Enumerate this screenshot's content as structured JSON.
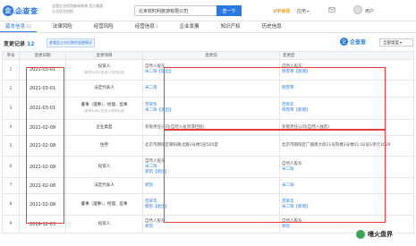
{
  "header": {
    "logo_char": "企",
    "logo_text": "企查查",
    "logo_domain": "qcc.com",
    "slogan": "全国企业信用查询系统 官方备案企业征信机构",
    "search_value": "北京欢时利旅游有限公司",
    "search_button": "查一下",
    "vip_label": "VIP会员",
    "app_label": "应用",
    "user_name": "用户"
  },
  "tabs": [
    {
      "label": "基本信息",
      "count": "33"
    },
    {
      "label": "法律风险",
      "count": ""
    },
    {
      "label": "经营风险",
      "count": ""
    },
    {
      "label": "经营信息",
      "count": "3"
    },
    {
      "label": "企业发展",
      "count": ""
    },
    {
      "label": "知识产权",
      "count": ""
    },
    {
      "label": "历史信息",
      "count": ""
    }
  ],
  "section": {
    "title": "变更记录",
    "count": "12",
    "hint": "查看此企业近期的变更情况",
    "logo_char": "企",
    "logo_text": "企查查",
    "filter_label": "全部类型"
  },
  "table": {
    "headers": [
      "序号",
      "变更日期",
      "变更项目",
      "变更前",
      "变更后"
    ],
    "rows": [
      {
        "no": "1",
        "date": "2021-03-01",
        "item": "投资人",
        "note": "(事项为何以投资人列项出现)",
        "before": [
          {
            "t": "自然人股东",
            "c": "g"
          },
          {
            "t": "米二阳【退出】",
            "c": "b"
          }
        ],
        "after": [
          {
            "t": "自然人股东",
            "c": "g"
          },
          {
            "t": "晓雪琴【新增】",
            "c": "b"
          }
        ]
      },
      {
        "no": "2",
        "date": "2021-03-01",
        "item": "法定代表人",
        "note": "",
        "before": [
          {
            "t": "米二阳",
            "c": "b"
          }
        ],
        "after": [
          {
            "t": "晓雪琴",
            "c": "b"
          }
        ]
      },
      {
        "no": "3",
        "date": "2021-03-01",
        "item": "董事（理事）、经理、监事",
        "note": "(事项为何以投资人列项出现)",
        "before": [
          {
            "t": "范荣华",
            "c": "b"
          },
          {
            "t": "米二阳【退出】",
            "c": "b"
          }
        ],
        "after": [
          {
            "t": "范荣华",
            "c": "b"
          },
          {
            "t": "晓雪琴【新增】",
            "c": "b"
          }
        ]
      },
      {
        "no": "4",
        "date": "2021-02-08",
        "item": "企业类型",
        "note": "",
        "before": [
          {
            "t": "有限责任公司(自然人投资或控股)",
            "c": "g"
          }
        ],
        "after": [
          {
            "t": "有限责任公司(自然人独资)",
            "c": "g"
          }
        ]
      },
      {
        "no": "5",
        "date": "2021-02-08",
        "item": "住所",
        "note": "",
        "before": [
          {
            "t": "北京市朝阳区朝阳路北路2号楼5层505室",
            "c": "g"
          }
        ],
        "after": [
          {
            "t": "北京市朝阳区广顺南大街21号院楼2号楼01-02层1单元1029",
            "c": "g"
          }
        ]
      },
      {
        "no": "6",
        "date": "2021-02-08",
        "item": "投资人",
        "note": "",
        "before": [
          {
            "t": "自然人股东",
            "c": "g"
          },
          {
            "t": "米二阳",
            "c": "b"
          },
          {
            "t": "郭凯【退出】",
            "c": "b"
          }
        ],
        "after": [
          {
            "t": "自然人股东",
            "c": "g"
          },
          {
            "t": "米二阳",
            "c": "b"
          }
        ]
      },
      {
        "no": "7",
        "date": "2021-02-08",
        "item": "法定代表人",
        "note": "",
        "before": [
          {
            "t": "郭凯",
            "c": "b"
          }
        ],
        "after": [
          {
            "t": "米二阳",
            "c": "b"
          }
        ]
      },
      {
        "no": "8",
        "date": "2021-02-08",
        "item": "董事（理事）、经理、监事",
        "note": "",
        "before": [
          {
            "t": "范荣华",
            "c": "b"
          },
          {
            "t": "郭凯【退出】",
            "c": "b"
          }
        ],
        "after": [
          {
            "t": "范荣华",
            "c": "b"
          },
          {
            "t": "米二阳【新增】",
            "c": "b"
          }
        ]
      },
      {
        "no": "9",
        "date": "2019-12-03",
        "item": "投资人",
        "note": "",
        "before": [
          {
            "t": "自然人股东",
            "c": "g"
          },
          {
            "t": "郭凯",
            "c": "b"
          }
        ],
        "after": [
          {
            "t": "自然人股东",
            "c": "g"
          },
          {
            "t": "郭凯",
            "c": "b"
          }
        ]
      }
    ]
  },
  "watermark": {
    "text": "嗜火盘界"
  },
  "colors": {
    "accent": "#2a7ae2",
    "highlight": "#e53c3c",
    "header_bg": "#f3f7fc"
  }
}
